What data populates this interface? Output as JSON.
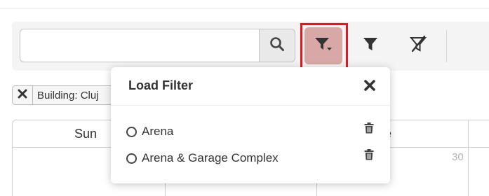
{
  "toolbar": {
    "search": {
      "value": "",
      "placeholder": "",
      "button_icon": "search-icon"
    },
    "buttons": [
      {
        "name": "load-filter",
        "icon": "filter-dropdown-icon",
        "highlighted": true
      },
      {
        "name": "apply-filter",
        "icon": "filter-icon"
      },
      {
        "name": "clear-filter",
        "icon": "filter-clear-icon"
      }
    ]
  },
  "active_filter_chip": {
    "label": "Building: Cluj",
    "close_icon": "close-icon"
  },
  "calendar": {
    "days": [
      "Sun",
      "ue"
    ],
    "visible_date": "30"
  },
  "load_filter_popover": {
    "title": "Load Filter",
    "close_icon": "close-icon",
    "filters": [
      {
        "label": "Arena",
        "selected": false,
        "delete_icon": "trash-icon"
      },
      {
        "label": "Arena & Garage Complex",
        "selected": false,
        "delete_icon": "trash-icon"
      }
    ]
  },
  "colors": {
    "highlight_border": "#e8151d",
    "active_button_bg": "#d8a8a6",
    "toolbar_bg": "#f4f4f4",
    "icon_dark": "#333333"
  }
}
